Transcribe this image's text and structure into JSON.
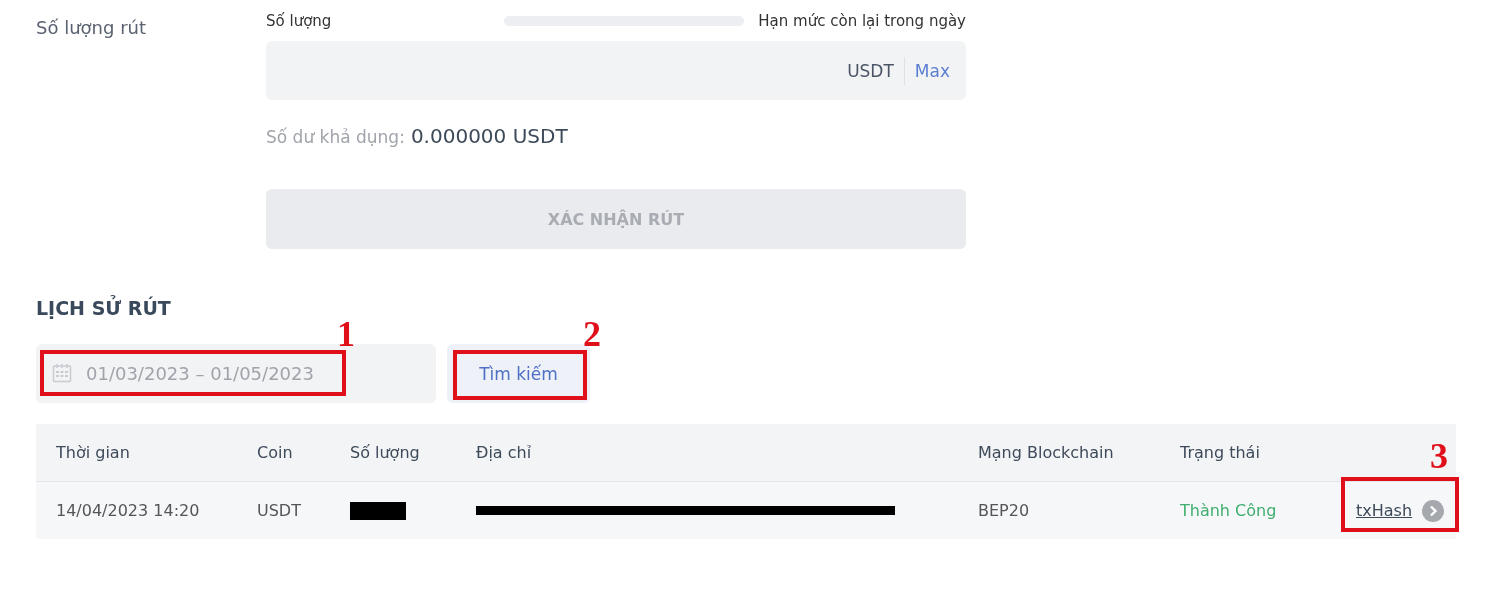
{
  "withdraw_form": {
    "label": "Số lượng rút",
    "amount_label": "Số lượng",
    "limit_meter": {
      "level": 0
    },
    "limit_label": "Hạn mức còn lại trong ngày",
    "amount_field": {
      "unit": "USDT",
      "max_link": "Max"
    },
    "balance_label": "Số dư khả dụng:",
    "balance_value": "0.000000 USDT",
    "confirm_button": {
      "label": "XÁC NHẬN RÚT",
      "disabled": true
    }
  },
  "history": {
    "title": "LỊCH SỬ RÚT",
    "date_range": {
      "placeholder": "01/03/2023 – 01/05/2023",
      "annotation": "1"
    },
    "search_button": {
      "label": "Tìm kiếm",
      "annotation": "2"
    },
    "table": {
      "columns": [
        "Thời gian",
        "Coin",
        "Số lượng",
        "Địa chỉ",
        "Mạng Blockchain",
        "Trạng thái"
      ],
      "rows": [
        {
          "time": "14/04/2023 14:20",
          "coin": "USDT",
          "amount_redacted": true,
          "address_redacted": true,
          "network": "BEP20",
          "status": "Thành Công",
          "color": "#3fae6f",
          "link": "txHash",
          "link_annotation": "3"
        }
      ]
    }
  }
}
